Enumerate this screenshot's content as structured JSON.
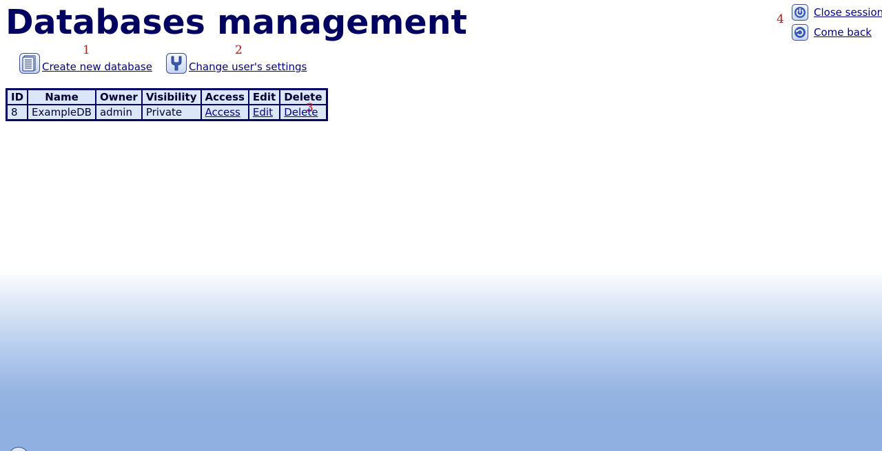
{
  "page": {
    "title": "Databases management"
  },
  "actions": [
    {
      "label": "Create new database",
      "icon": "document-list-icon",
      "marker": "1"
    },
    {
      "label": "Change user's settings",
      "icon": "wrench-icon",
      "marker": "2"
    }
  ],
  "table": {
    "marker": "3",
    "columns": [
      "ID",
      "Name",
      "Owner",
      "Visibility",
      "Access",
      "Edit",
      "Delete"
    ],
    "rows": [
      {
        "id": "8",
        "name": "ExampleDB",
        "owner": "admin",
        "visibility": "Private",
        "access": "Access",
        "edit": "Edit",
        "delete": "Delete"
      }
    ]
  },
  "session": {
    "marker": "4",
    "close_label": "Close session",
    "close_icon": "power-icon",
    "back_label": "Come back",
    "back_icon": "back-arrow-icon"
  },
  "colors": {
    "title": "#000060",
    "link": "#000080",
    "marker": "#c0101a",
    "table_border": "#000060",
    "table_cell_bg": "#dbe6f8",
    "gradient_bottom": "#8fb0e0"
  }
}
